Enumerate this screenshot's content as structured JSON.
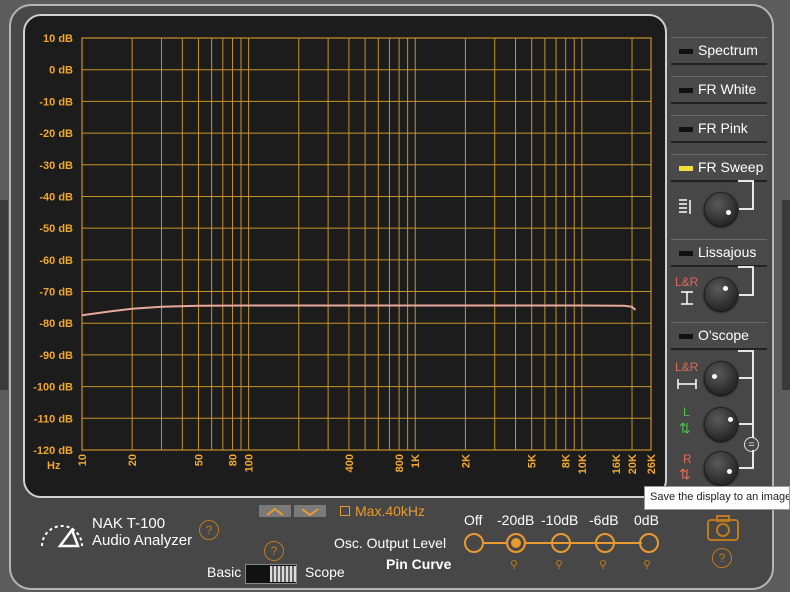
{
  "chart_data": {
    "type": "line",
    "y_ticks": [
      "10 dB",
      "0 dB",
      "-10 dB",
      "-20 dB",
      "-30 dB",
      "-40 dB",
      "-50 dB",
      "-60 dB",
      "-70 dB",
      "-80 dB",
      "-90 dB",
      "-100 dB",
      "-110 dB",
      "-120 dB"
    ],
    "ylim": [
      -120,
      10
    ],
    "x_unit_label": "Hz",
    "x_ticks": [
      {
        "f": 10,
        "label": "10"
      },
      {
        "f": 20,
        "label": "20"
      },
      {
        "f": 50,
        "label": "50"
      },
      {
        "f": 80,
        "label": "80"
      },
      {
        "f": 100,
        "label": "100"
      },
      {
        "f": 400,
        "label": "400"
      },
      {
        "f": 800,
        "label": "800"
      },
      {
        "f": 1000,
        "label": "1K"
      },
      {
        "f": 2000,
        "label": "2K"
      },
      {
        "f": 5000,
        "label": "5K"
      },
      {
        "f": 8000,
        "label": "8K"
      },
      {
        "f": 10000,
        "label": "10K"
      },
      {
        "f": 16000,
        "label": "16K"
      },
      {
        "f": 20000,
        "label": "20K"
      },
      {
        "f": 26000,
        "label": "26K"
      }
    ],
    "x_scale": "log",
    "xlim": [
      10,
      26000
    ],
    "grid": true,
    "series": [
      {
        "color": "#e8a99a",
        "x": [
          10,
          15,
          20,
          30,
          50,
          100,
          1000,
          10000,
          18000,
          20000,
          21000
        ],
        "y": [
          -77.5,
          -76.2,
          -75.4,
          -74.8,
          -74.5,
          -74.4,
          -74.4,
          -74.4,
          -74.5,
          -74.8,
          -75.8
        ]
      }
    ]
  },
  "modes": {
    "spectrum": "Spectrum",
    "fr_white": "FR White",
    "fr_pink": "FR Pink",
    "fr_sweep": "FR Sweep",
    "lissajous": "Lissajous",
    "oscope": "O'scope"
  },
  "knob_labels": {
    "lissajous_lr": "L&R",
    "oscope_lr": "L&R",
    "oscope_l": "L",
    "oscope_r": "R",
    "link": "="
  },
  "brand": {
    "model": "NAK T-100",
    "subtitle": "Audio Analyzer"
  },
  "range": {
    "max_label": "Max.40kHz"
  },
  "mode_switch": {
    "left": "Basic",
    "right": "Scope"
  },
  "osc": {
    "title": "Osc. Output Level",
    "subtitle": "Pin Curve",
    "levels": [
      "Off",
      "-20dB",
      "-10dB",
      "-6dB",
      "0dB"
    ],
    "selected": "-20dB"
  },
  "help_mark": "?",
  "tooltip": "Save the display to an image file",
  "colors": {
    "grid": "#c8922a",
    "axis_text": "#f0a830",
    "accent": "#e89a2e",
    "trace": "#e8a99a",
    "indicator_on": "#f2dc3a"
  }
}
